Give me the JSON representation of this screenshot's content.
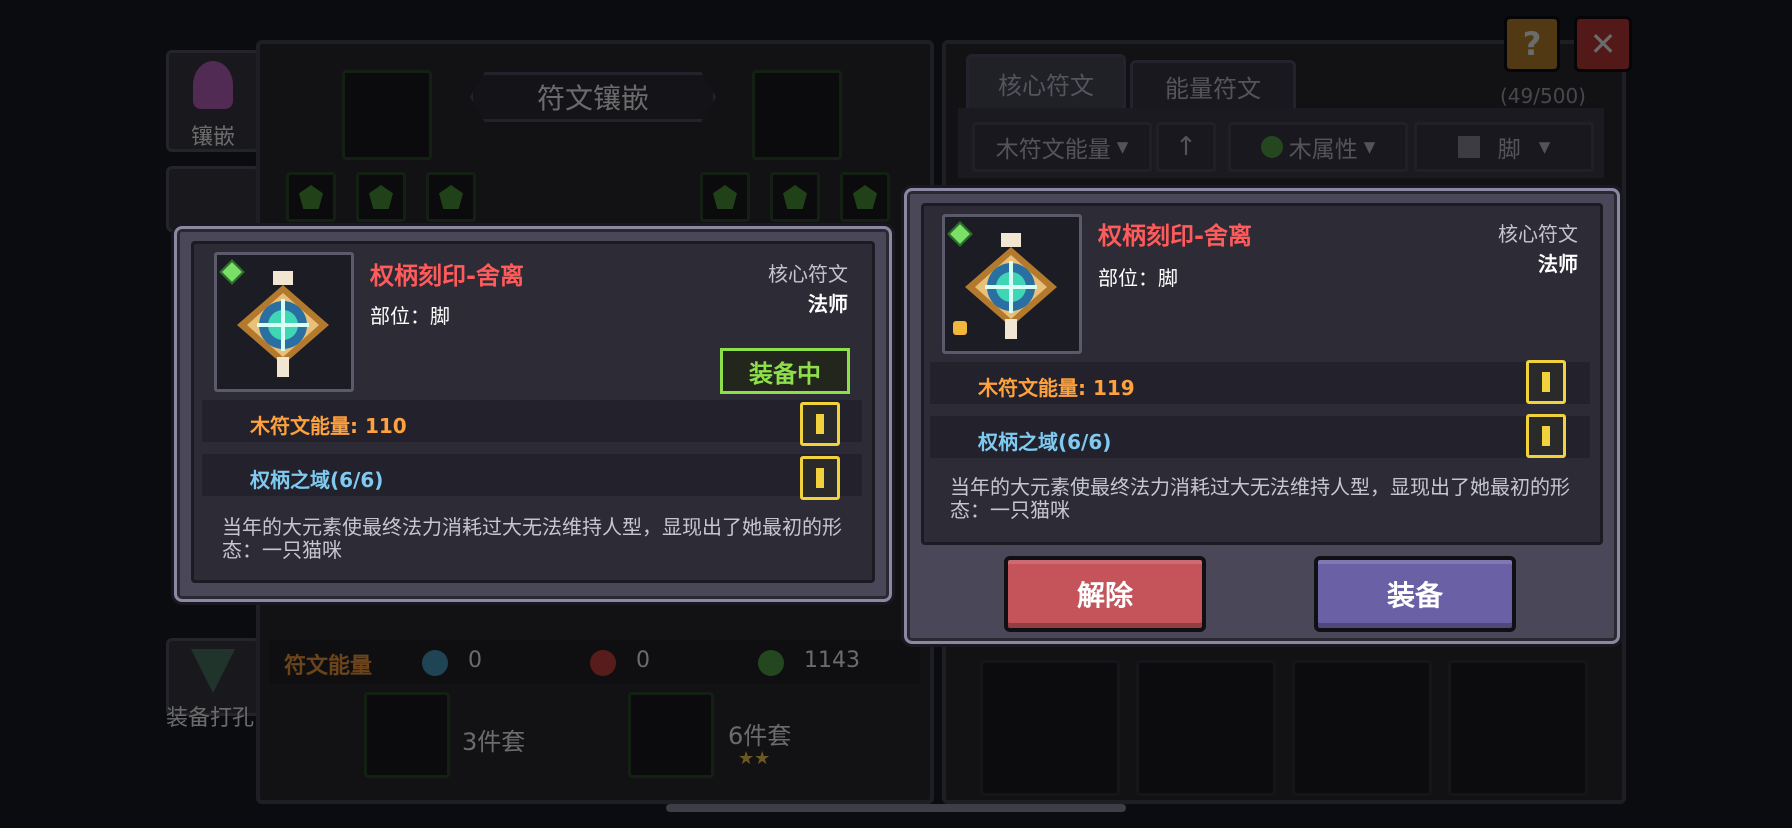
{
  "background": {
    "side_tabs": [
      {
        "label": "镶嵌"
      },
      {
        "label": "装备打孔"
      }
    ],
    "socket_panel": {
      "title": "符文镶嵌"
    },
    "energy": {
      "label": "符文能量",
      "values": [
        "0",
        "0",
        "1143"
      ]
    },
    "sets": [
      {
        "label": "3件套"
      },
      {
        "label": "6件套",
        "stars": "★★"
      }
    ],
    "right_panel": {
      "tabs": [
        "核心符文",
        "能量符文"
      ],
      "count": "(49/500)",
      "filters": {
        "energy_sort": "木符文能量",
        "element": "木属性",
        "part": "脚"
      }
    },
    "top_buttons": {
      "help": "?",
      "close": "✕"
    }
  },
  "left_card": {
    "name": "权柄刻印-舍离",
    "type": "核心符文",
    "class": "法师",
    "part_label": "部位：脚",
    "equipped_badge": "装备中",
    "stat1": "木符文能量: 110",
    "stat2": "权柄之域(6/6)",
    "description": "当年的大元素使最终法力消耗过大无法维持人型，显现出了她最初的形态：一只猫咪"
  },
  "right_card": {
    "name": "权柄刻印-舍离",
    "type": "核心符文",
    "class": "法师",
    "part_label": "部位：脚",
    "stat1": "木符文能量: 119",
    "stat2": "权柄之域(6/6)",
    "description": "当年的大元素使最终法力消耗过大无法维持人型，显现出了她最初的形态：一只猫咪",
    "remove_label": "解除",
    "equip_label": "装备"
  },
  "colors": {
    "name": "#ff5b5b",
    "energy": "#ffa13d",
    "set_effect": "#7fcaf0",
    "remove_button": "#c4535a",
    "equip_button": "#6a60a6",
    "equipped_badge": "#8ee04a"
  }
}
